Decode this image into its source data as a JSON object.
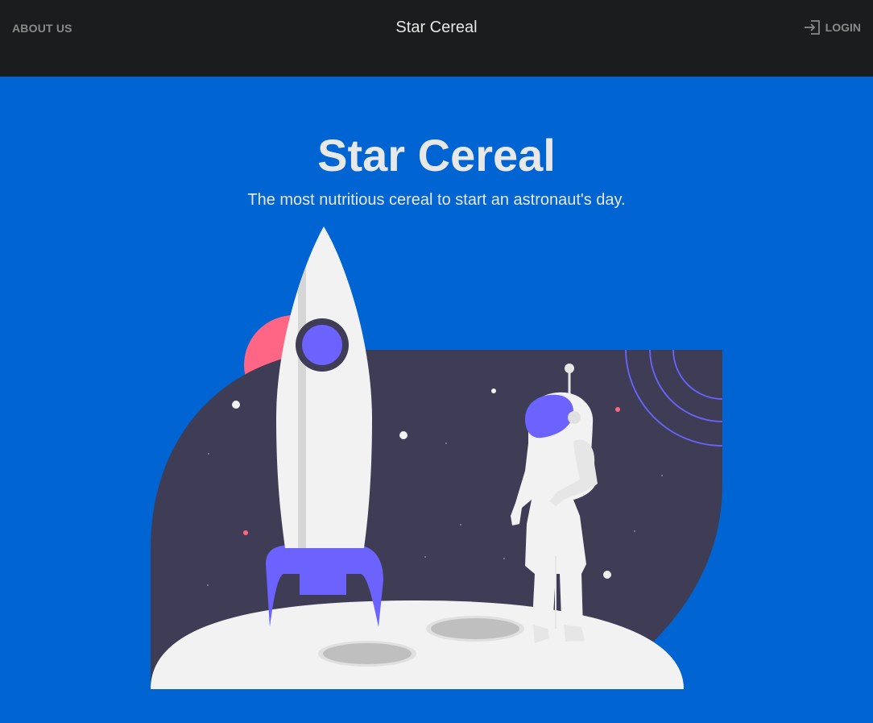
{
  "nav": {
    "about_label": "ABOUT US",
    "brand_title": "Star Cereal",
    "login_label": "LOGIN",
    "login_icon": "sign-in-icon"
  },
  "hero": {
    "title": "Star Cereal",
    "subtitle": "The most nutritious cereal to start an astronaut's day."
  },
  "illustration": {
    "name": "astronaut-rocket-moon",
    "colors": {
      "background": "#0064d2",
      "space": "#3f3d56",
      "moon": "#f2f2f2",
      "accent": "#6c63ff",
      "planet": "#ff6584"
    }
  }
}
